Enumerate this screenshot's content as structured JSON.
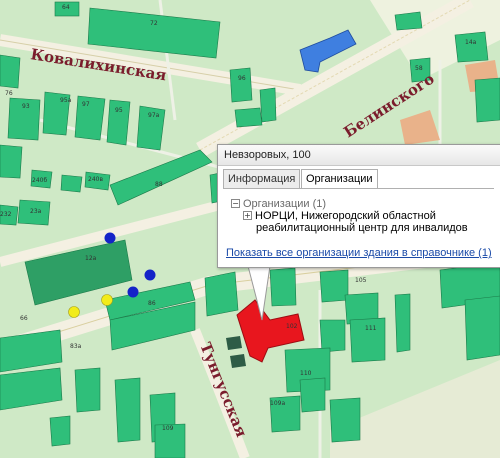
{
  "map": {
    "streets": [
      {
        "id": "kovalikhinskaya",
        "name": "Ковалихинская"
      },
      {
        "id": "belinskogo",
        "name": "Белинского"
      },
      {
        "id": "tungusskaya",
        "name": "Тунгусская"
      }
    ],
    "building_numbers": [
      "64",
      "72",
      "76",
      "95a",
      "97",
      "97a",
      "95",
      "93",
      "240б",
      "240в",
      "88",
      "23a",
      "232",
      "12a",
      "86",
      "66",
      "14a",
      "58",
      "96",
      "102",
      "83a",
      "110",
      "111",
      "105",
      "109a",
      "109"
    ],
    "highlighted_building": {
      "label": "100",
      "color": "#e8161e"
    },
    "colors": {
      "building": "#2fbf7a",
      "building_dark": "#1e8c56",
      "highlight": "#e8161e",
      "blue_building": "#3f7fe0",
      "road": "#f4f0e2",
      "stop_blue": "#1423c8",
      "stop_yellow": "#f2ec1a"
    }
  },
  "popup": {
    "title": "Невзоровых, 100",
    "tabs": [
      {
        "label": "Информация",
        "active": false
      },
      {
        "label": "Организации",
        "active": true
      }
    ],
    "tree": {
      "group": {
        "expander": "−",
        "label": "Организации (1)"
      },
      "item": {
        "expander": "+",
        "line1": "НОРЦИ, Нижегородский областной",
        "line2": "реабилитационный центр для инвалидов"
      }
    },
    "link": "Показать все организации здания в справочнике (1)"
  }
}
